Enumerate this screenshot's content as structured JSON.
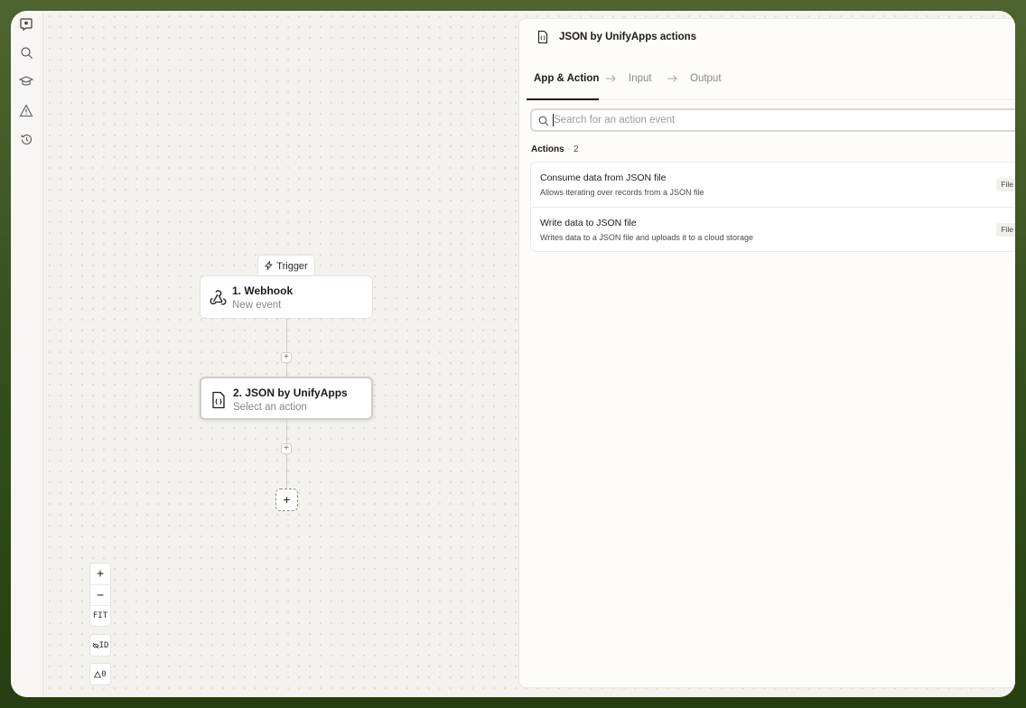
{
  "rail": {
    "items": [
      {
        "name": "logo-icon"
      },
      {
        "name": "search-icon"
      },
      {
        "name": "graduation-cap-icon"
      },
      {
        "name": "warning-icon"
      },
      {
        "name": "history-icon"
      }
    ]
  },
  "canvas": {
    "trigger_label": "Trigger",
    "nodes": [
      {
        "title": "1. Webhook",
        "subtitle": "New event",
        "icon": "webhook-icon"
      },
      {
        "title": "2. JSON by UnifyApps",
        "subtitle": "Select an action",
        "icon": "json-file-icon"
      }
    ],
    "add_step_symbol": "+",
    "zoom": {
      "in": "+",
      "out": "−",
      "fit": "FIT",
      "id_toggle": "ID",
      "warnings": "0"
    }
  },
  "panel": {
    "title": "JSON by UnifyApps actions",
    "tabs": [
      "App & Action",
      "Input",
      "Output"
    ],
    "active_tab": "App & Action",
    "search_placeholder": "Search for an action event",
    "actions_label": "Actions",
    "actions_count": "2",
    "actions": [
      {
        "title": "Consume data from JSON file",
        "description": "Allows iterating over records from a JSON file",
        "badge": "File"
      },
      {
        "title": "Write data to JSON file",
        "description": "Writes data to a JSON file and uploads it to a cloud storage",
        "badge": "File"
      }
    ]
  }
}
